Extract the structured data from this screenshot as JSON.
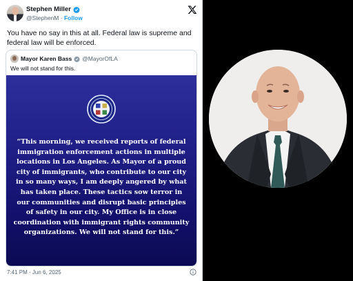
{
  "tweet": {
    "author_name": "Stephen Miller",
    "author_handle": "@StephenM",
    "separator": " · ",
    "follow_label": "Follow",
    "text": "You have no say in this at all. Federal law is supreme and federal law will be enforced.",
    "timestamp": "7:41 PM · Jun 6, 2025"
  },
  "quote": {
    "author_name": "Mayor Karen Bass",
    "author_handle": "@MayorOfLA",
    "text": "We will not stand for this.",
    "image_statement": "“This morning, we received reports of federal immigration enforcement actions in multiple locations in Los Angeles. As Mayor of a proud city of immigrants, who contribute to our city in so many ways, I am deeply angered by what has taken place. These tactics sow terror in our communities and disrupt basic principles of safety in our city. My Office is in close coordination with immigrant rights community organizations. We will not stand for this.”"
  },
  "icons": {
    "verified": "verified-badge-icon",
    "platform": "x-logo-icon",
    "info": "info-icon",
    "seal": "city-seal-icon"
  },
  "colors": {
    "link": "#1d9bf0",
    "verified": "#1d9bf0",
    "quote_image_top": "#2e2f9c",
    "quote_image_bottom": "#0b0a52",
    "background": "#000000"
  }
}
